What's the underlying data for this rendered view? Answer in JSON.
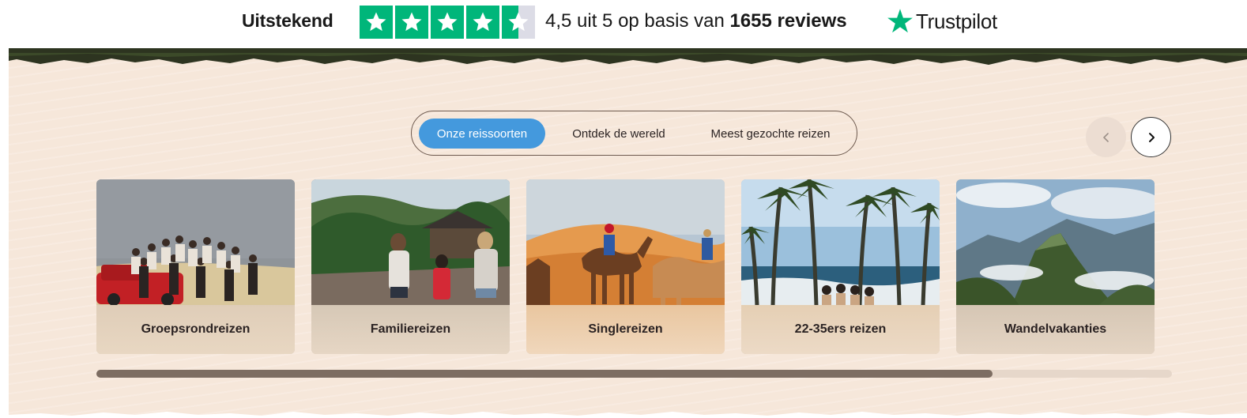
{
  "trustpilot": {
    "rating_word": "Uitstekend",
    "summary_text": "4,5 uit 5 op basis van ",
    "reviews_text": "1655 reviews",
    "logo_word": "Trustpilot",
    "rating_value": 4.5,
    "star_color": "#00b67a"
  },
  "tabs": [
    {
      "label": "Onze reissoorten",
      "active": true
    },
    {
      "label": "Ontdek de wereld",
      "active": false
    },
    {
      "label": "Meest gezochte reizen",
      "active": false
    }
  ],
  "navigation": {
    "prev_icon": "chevron-left-icon",
    "next_icon": "chevron-right-icon"
  },
  "cards": [
    {
      "label": "Groepsrondreizen"
    },
    {
      "label": "Familiereizen"
    },
    {
      "label": "Singlereizen"
    },
    {
      "label": "22-35ers reizen"
    },
    {
      "label": "Wandelvakanties"
    }
  ],
  "scroll": {
    "visible_fraction": 0.833
  },
  "colors": {
    "accent": "#4499dd",
    "section_bg": "#f6e7da",
    "trustpilot_green": "#00b67a"
  }
}
